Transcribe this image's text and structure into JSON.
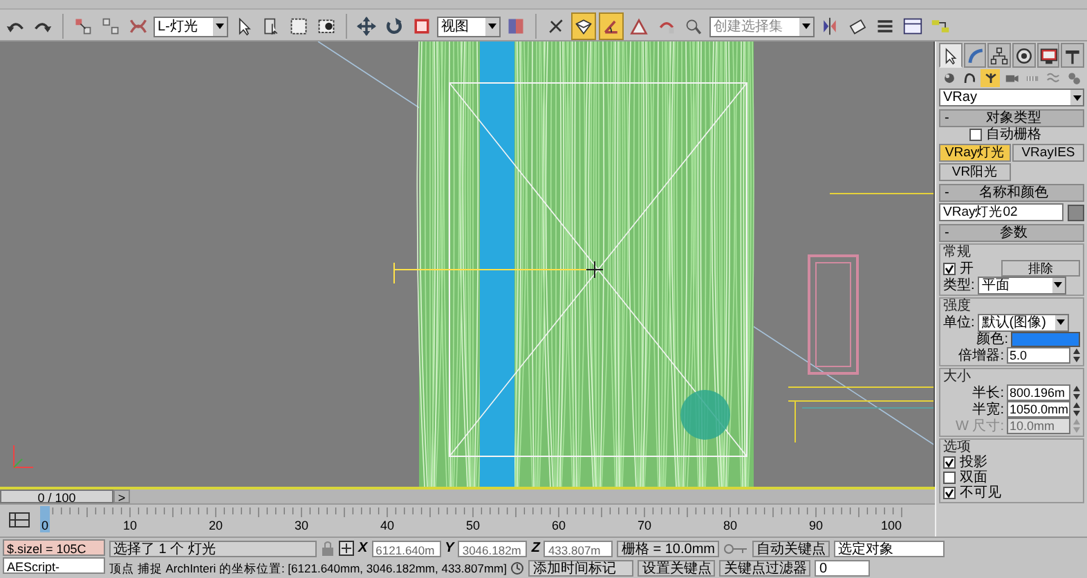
{
  "toolbar": {
    "tools": [
      {
        "kind": "undo",
        "active": false
      },
      {
        "kind": "redo",
        "active": false
      },
      {
        "kind": "separator"
      },
      {
        "kind": "link",
        "active": false
      },
      {
        "kind": "unlink",
        "active": false
      },
      {
        "kind": "bind",
        "active": false
      },
      {
        "kind": "dropdown",
        "value": "L-灯光"
      },
      {
        "kind": "select",
        "active": false
      },
      {
        "kind": "select-list",
        "active": false
      },
      {
        "kind": "region",
        "active": false
      },
      {
        "kind": "crossing",
        "active": false
      },
      {
        "kind": "separator"
      },
      {
        "kind": "move",
        "active": false
      },
      {
        "kind": "rotate",
        "active": false
      },
      {
        "kind": "scale",
        "active": false
      },
      {
        "kind": "dropdown",
        "value": "视图"
      },
      {
        "kind": "pivot",
        "active": false
      },
      {
        "kind": "separator"
      },
      {
        "kind": "manipulate",
        "active": false
      },
      {
        "kind": "snap",
        "active": true
      },
      {
        "kind": "angle-snap",
        "active": true
      },
      {
        "kind": "percent-snap",
        "active": false
      },
      {
        "kind": "spinner-snap",
        "active": false
      },
      {
        "kind": "named-sets",
        "active": false
      },
      {
        "kind": "dropdown",
        "placeholder": "创建选择集"
      },
      {
        "kind": "mirror",
        "active": false
      },
      {
        "kind": "align",
        "active": false
      },
      {
        "kind": "layers",
        "active": false
      },
      {
        "kind": "curve-editor",
        "active": false
      },
      {
        "kind": "schematic",
        "active": false
      }
    ]
  },
  "command_panel": {
    "tabs": [
      {
        "kind": "create",
        "selected": true
      },
      {
        "kind": "modify",
        "selected": false
      },
      {
        "kind": "hierarchy",
        "selected": false
      },
      {
        "kind": "motion",
        "selected": false
      },
      {
        "kind": "display",
        "selected": false
      },
      {
        "kind": "utilities",
        "selected": false
      }
    ],
    "subtabs": [
      {
        "kind": "geometry",
        "selected": false
      },
      {
        "kind": "shapes",
        "selected": false
      },
      {
        "kind": "lights",
        "selected": true
      },
      {
        "kind": "cameras",
        "selected": false
      },
      {
        "kind": "helpers",
        "selected": false
      },
      {
        "kind": "spacewarps",
        "selected": false
      },
      {
        "kind": "systems",
        "selected": false
      }
    ],
    "category": "VRay",
    "object_type": {
      "collapse_mark": "-",
      "title": "对象类型",
      "autogrid": {
        "label": "自动栅格",
        "checked": false
      },
      "buttons": [
        {
          "label": "VRay灯光",
          "selected": true
        },
        {
          "label": "VRayIES",
          "selected": false
        },
        {
          "label": "VR阳光",
          "selected": false
        }
      ]
    },
    "name_color": {
      "collapse_mark": "-",
      "title": "名称和颜色",
      "name": "VRay灯光02"
    },
    "parameters": {
      "collapse_mark": "-",
      "title": "参数",
      "general": {
        "title": "常规",
        "on": {
          "label": "开",
          "checked": true
        },
        "exclude": "排除",
        "type_label": "类型:",
        "type": "平面"
      },
      "intensity": {
        "title": "强度",
        "units_label": "单位:",
        "units": "默认(图像)",
        "color_label": "颜色:",
        "multiplier_label": "倍增器:",
        "multiplier": "5.0"
      },
      "size": {
        "title": "大小",
        "fields": [
          {
            "label": "半长:",
            "value": "800.196m",
            "disabled": false
          },
          {
            "label": "半宽:",
            "value": "1050.0mm",
            "disabled": false
          },
          {
            "label": "W 尺寸:",
            "value": "10.0mm",
            "disabled": true
          }
        ]
      },
      "options": {
        "title": "选项",
        "checks": [
          {
            "label": "投影",
            "checked": true
          },
          {
            "label": "双面",
            "checked": false
          },
          {
            "label": "不可见",
            "checked": true
          }
        ]
      }
    }
  },
  "timeline": {
    "position": "0 / 100",
    "next": ">",
    "frames": [
      {
        "label": "0",
        "selected": true
      },
      {
        "label": "10",
        "selected": false
      },
      {
        "label": "20",
        "selected": false
      },
      {
        "label": "30",
        "selected": false
      },
      {
        "label": "40",
        "selected": false
      },
      {
        "label": "50",
        "selected": false
      },
      {
        "label": "60",
        "selected": false
      },
      {
        "label": "70",
        "selected": false
      },
      {
        "label": "80",
        "selected": false
      },
      {
        "label": "90",
        "selected": false
      },
      {
        "label": "100",
        "selected": false
      }
    ]
  },
  "status_bar": {
    "listener": "$.sizel = 105C",
    "script_label": "AEScript-",
    "selection": "选择了 1 个 灯光",
    "coords": [
      {
        "axis": "X",
        "value": "6121.640m"
      },
      {
        "axis": "Y",
        "value": "3046.182m"
      },
      {
        "axis": "Z",
        "value": "433.807m"
      }
    ],
    "grid": "栅格 = 10.0mm",
    "prompt": "顶点 捕捉 ArchInteri 的坐标位置: [6121.640mm, 3046.182mm, 433.807mm]",
    "add_time_tag": "添加时间标记",
    "auto_key": "自动关键点",
    "key_target": "选定对象",
    "set_key": "设置关键点",
    "key_filters": "关键点过滤器",
    "frame": "0"
  }
}
